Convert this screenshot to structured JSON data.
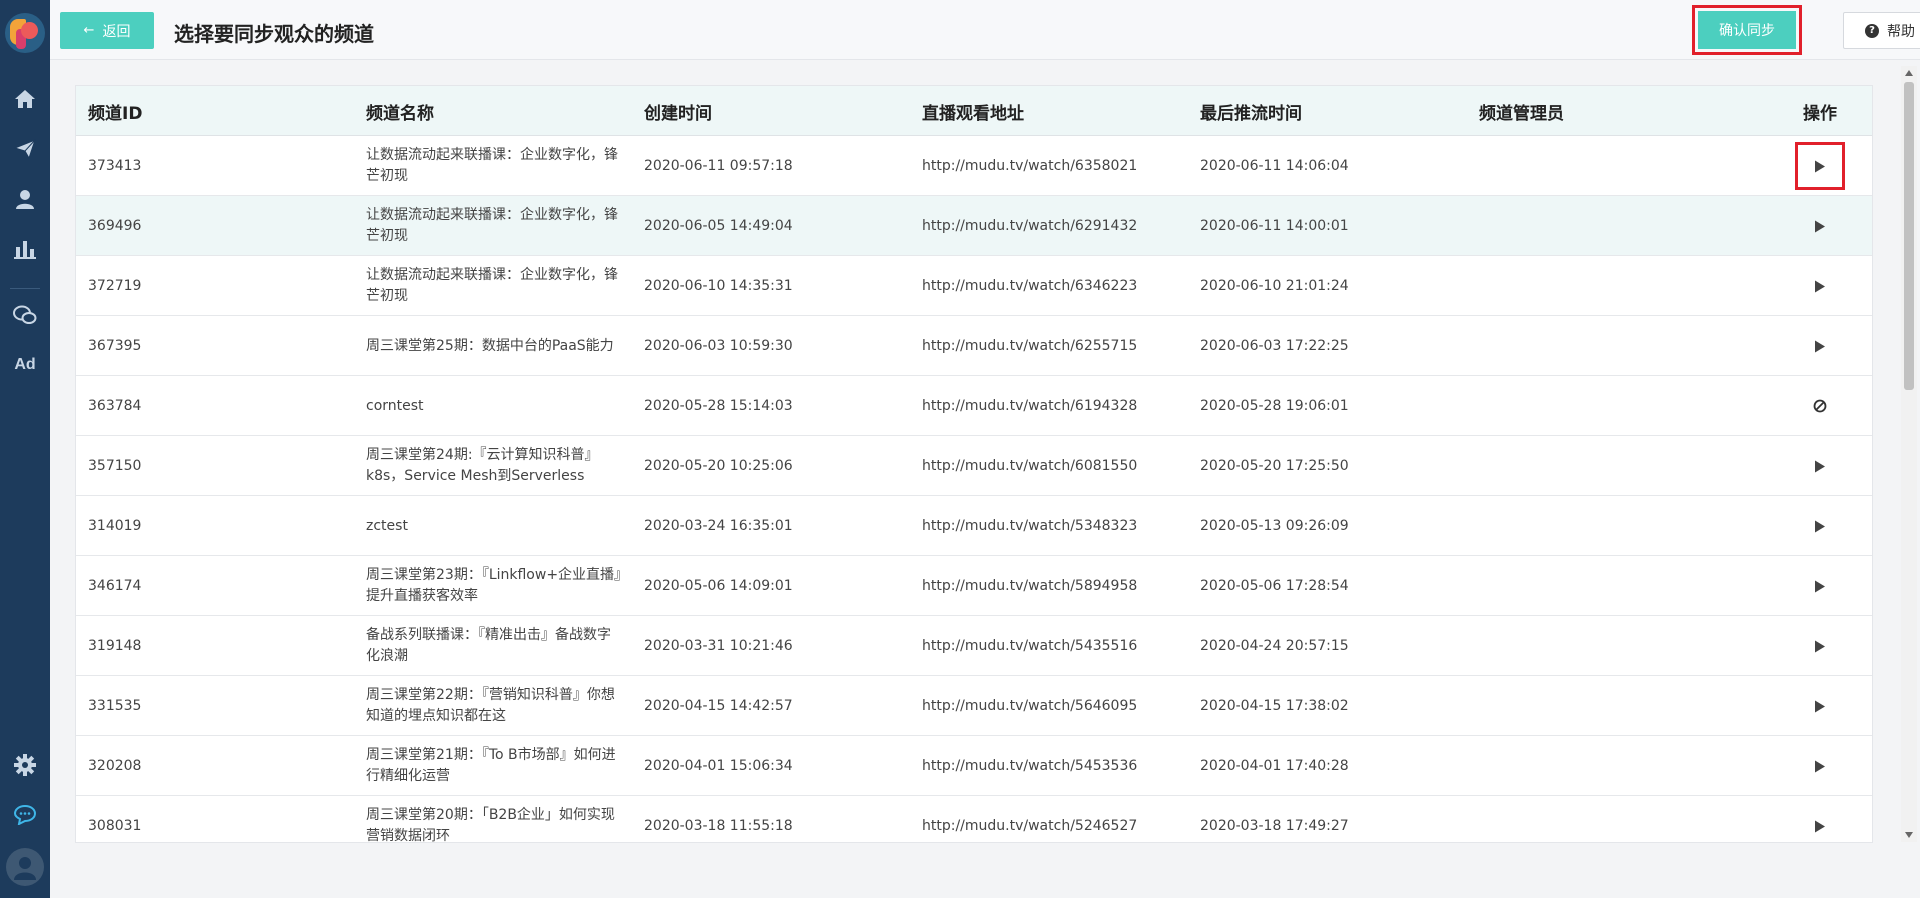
{
  "header": {
    "back_label": "返回",
    "title": "选择要同步观众的频道",
    "confirm_label": "确认同步",
    "help_label": "帮助"
  },
  "sidebar": {
    "items": [
      {
        "icon": "home-icon"
      },
      {
        "icon": "send-icon"
      },
      {
        "icon": "user-icon"
      },
      {
        "icon": "bar-chart-icon"
      },
      {
        "icon": "wechat-icon"
      },
      {
        "icon": "ad-icon",
        "label": "Ad"
      }
    ],
    "bottom": [
      {
        "icon": "gear-icon"
      },
      {
        "icon": "chat-bubble-icon"
      }
    ]
  },
  "table": {
    "columns": [
      "频道ID",
      "频道名称",
      "创建时间",
      "直播观看地址",
      "最后推流时间",
      "频道管理员",
      "操作"
    ],
    "rows": [
      {
        "id": "373413",
        "name": "让数据流动起来联播课：企业数字化，锋芒初现",
        "created": "2020-06-11 09:57:18",
        "url": "http://mudu.tv/watch/6358021",
        "last_push": "2020-06-11 14:06:04",
        "admin": "",
        "op": "play"
      },
      {
        "id": "369496",
        "name": "让数据流动起来联播课：企业数字化，锋芒初现",
        "created": "2020-06-05 14:49:04",
        "url": "http://mudu.tv/watch/6291432",
        "last_push": "2020-06-11 14:00:01",
        "admin": "",
        "op": "play"
      },
      {
        "id": "372719",
        "name": "让数据流动起来联播课：企业数字化，锋芒初现",
        "created": "2020-06-10 14:35:31",
        "url": "http://mudu.tv/watch/6346223",
        "last_push": "2020-06-10 21:01:24",
        "admin": "",
        "op": "play"
      },
      {
        "id": "367395",
        "name": "周三课堂第25期：数据中台的PaaS能力",
        "created": "2020-06-03 10:59:30",
        "url": "http://mudu.tv/watch/6255715",
        "last_push": "2020-06-03 17:22:25",
        "admin": "",
        "op": "play"
      },
      {
        "id": "363784",
        "name": "corntest",
        "created": "2020-05-28 15:14:03",
        "url": "http://mudu.tv/watch/6194328",
        "last_push": "2020-05-28 19:06:01",
        "admin": "",
        "op": "disabled"
      },
      {
        "id": "357150",
        "name": "周三课堂第24期:『云计算知识科普』k8s，Service Mesh到Serverless",
        "created": "2020-05-20 10:25:06",
        "url": "http://mudu.tv/watch/6081550",
        "last_push": "2020-05-20 17:25:50",
        "admin": "",
        "op": "play"
      },
      {
        "id": "314019",
        "name": "zctest",
        "created": "2020-03-24 16:35:01",
        "url": "http://mudu.tv/watch/5348323",
        "last_push": "2020-05-13 09:26:09",
        "admin": "",
        "op": "play"
      },
      {
        "id": "346174",
        "name": "周三课堂第23期：『Linkflow+企业直播』提升直播获客效率",
        "created": "2020-05-06 14:09:01",
        "url": "http://mudu.tv/watch/5894958",
        "last_push": "2020-05-06 17:28:54",
        "admin": "",
        "op": "play"
      },
      {
        "id": "319148",
        "name": "备战系列联播课：『精准出击』备战数字化浪潮",
        "created": "2020-03-31 10:21:46",
        "url": "http://mudu.tv/watch/5435516",
        "last_push": "2020-04-24 20:57:15",
        "admin": "",
        "op": "play"
      },
      {
        "id": "331535",
        "name": "周三课堂第22期：『营销知识科普』你想知道的埋点知识都在这",
        "created": "2020-04-15 14:42:57",
        "url": "http://mudu.tv/watch/5646095",
        "last_push": "2020-04-15 17:38:02",
        "admin": "",
        "op": "play"
      },
      {
        "id": "320208",
        "name": "周三课堂第21期：『To B市场部』如何进行精细化运营",
        "created": "2020-04-01 15:06:34",
        "url": "http://mudu.tv/watch/5453536",
        "last_push": "2020-04-01 17:40:28",
        "admin": "",
        "op": "play"
      },
      {
        "id": "308031",
        "name": "周三课堂第20期：「B2B企业」如何实现营销数据闭环",
        "created": "2020-03-18 11:55:18",
        "url": "http://mudu.tv/watch/5246527",
        "last_push": "2020-03-18 17:49:27",
        "admin": "",
        "op": "play"
      }
    ]
  },
  "colors": {
    "sidebar": "#1d3b5c",
    "accent": "#4ccfbf",
    "highlight_border": "#e1202b",
    "header_row": "#eef7f7"
  }
}
